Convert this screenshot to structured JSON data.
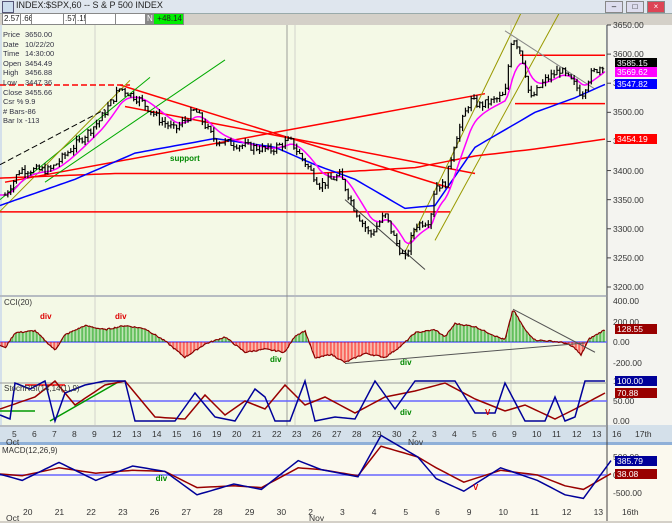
{
  "window": {
    "title": "INDEX:$SPX,60 -- S & P 500 INDEX",
    "buttons": [
      "–",
      "□",
      "×"
    ]
  },
  "toolbar": {
    "fields": [
      "2.57",
      ".66",
      "",
      ".57",
      ".15",
      "",
      ""
    ],
    "flag": "N",
    "change": "+48.14"
  },
  "info": [
    [
      "Price",
      "3650.00"
    ],
    [
      "Date",
      "10/22/20"
    ],
    [
      "Time",
      "14:30:00"
    ],
    [
      "Open",
      "3454.49"
    ],
    [
      "High",
      "3456.88"
    ],
    [
      "Low",
      "3447.36"
    ],
    [
      "Close",
      "3455.66"
    ],
    [
      "Csr %",
      "9.9"
    ],
    [
      "# Bars",
      "-86"
    ],
    [
      "Bar Ix",
      "-113"
    ]
  ],
  "colors": {
    "price": "#000000",
    "ema_fast": "#ff00ff",
    "ema_mid": "#0000ff",
    "ma_slow": "#ff0000",
    "cci_up": "#009900",
    "cci_down": "#ff0000",
    "stoch_k": "#000099",
    "stoch_d": "#990000",
    "macd": "#000099",
    "signal": "#990000",
    "zero": "#6666ff",
    "bg": "#f4f9e6"
  },
  "chart_data": [
    {
      "type": "line",
      "title": "INDEX:$SPX,60 -- S & P 500 INDEX",
      "ylim": [
        3180,
        3680
      ],
      "yticks": [
        "3650.00",
        "3600.00",
        "3550.00",
        "3500.00",
        "3450.00",
        "3400.00",
        "3350.00",
        "3300.00",
        "3250.00",
        "3200.00"
      ],
      "last_values": {
        "price": "3585.15",
        "ema_fast": "3569.62",
        "ema_mid": "3547.82",
        "ma_slow": "3454.19"
      },
      "price_path": [
        [
          -0.5,
          3358
        ],
        [
          0.25,
          3401
        ],
        [
          1.75,
          3401
        ],
        [
          3.25,
          3452
        ],
        [
          4.25,
          3487
        ],
        [
          5.25,
          3542
        ],
        [
          6.25,
          3521
        ],
        [
          7.25,
          3487
        ],
        [
          8,
          3470
        ],
        [
          9,
          3504
        ],
        [
          10,
          3452
        ],
        [
          11.25,
          3444
        ],
        [
          12.75,
          3435
        ],
        [
          13.75,
          3452
        ],
        [
          14.75,
          3401
        ],
        [
          15.25,
          3375
        ],
        [
          16.25,
          3392
        ],
        [
          17,
          3332
        ],
        [
          17.75,
          3289
        ],
        [
          18.5,
          3324
        ],
        [
          19,
          3281
        ],
        [
          19.5,
          3246
        ],
        [
          20,
          3306
        ],
        [
          20.75,
          3315
        ],
        [
          21,
          3375
        ],
        [
          21.5,
          3375
        ],
        [
          22,
          3452
        ],
        [
          22.75,
          3521
        ],
        [
          23.25,
          3512
        ],
        [
          24,
          3521
        ],
        [
          24.5,
          3530
        ],
        [
          24.85,
          3633
        ],
        [
          25.25,
          3607
        ],
        [
          25.5,
          3573
        ],
        [
          25.75,
          3521
        ],
        [
          26.5,
          3555
        ],
        [
          27.25,
          3573
        ],
        [
          28,
          3547
        ],
        [
          28.35,
          3530
        ],
        [
          28.75,
          3564
        ],
        [
          29.5,
          3585
        ]
      ],
      "ema_mid_path": [
        [
          -0.75,
          3340
        ],
        [
          3,
          3385
        ],
        [
          6,
          3430
        ],
        [
          10,
          3455
        ],
        [
          13,
          3440
        ],
        [
          15,
          3410
        ],
        [
          17,
          3385
        ],
        [
          19.5,
          3335
        ],
        [
          21,
          3340
        ],
        [
          23,
          3440
        ],
        [
          26,
          3500
        ],
        [
          28,
          3525
        ],
        [
          29.5,
          3548
        ]
      ],
      "ma_slow_path": [
        [
          -0.75,
          3387
        ],
        [
          5,
          3395
        ],
        [
          10,
          3395
        ],
        [
          15,
          3395
        ],
        [
          20,
          3405
        ],
        [
          23,
          3425
        ],
        [
          26,
          3437
        ],
        [
          29.5,
          3454
        ]
      ],
      "annotations": [
        {
          "text": "support",
          "at": [
            7.75,
            3420
          ]
        }
      ],
      "trendlines": [
        {
          "color": "#ff0000",
          "dash": false,
          "pts": [
            [
              -0.75,
              3329
            ],
            [
              21.75,
              3329
            ]
          ]
        },
        {
          "color": "#ff0000",
          "dash": true,
          "pts": [
            [
              -0.75,
              3547
            ],
            [
              5.75,
              3547
            ]
          ]
        },
        {
          "color": "#ff0000",
          "dash": false,
          "pts": [
            [
              5.25,
              3547
            ],
            [
              21.75,
              3370
            ]
          ]
        },
        {
          "color": "#ff0000",
          "dash": false,
          "pts": [
            [
              5.5,
              3510
            ],
            [
              23,
              3395
            ]
          ]
        },
        {
          "color": "#ff0000",
          "dash": false,
          "pts": [
            [
              -0.5,
              3380
            ],
            [
              23.5,
              3532
            ]
          ]
        },
        {
          "color": "#ff0000",
          "dash": false,
          "pts": [
            [
              25,
              3515
            ],
            [
              29.5,
              3515
            ]
          ]
        },
        {
          "color": "#ff0000",
          "dash": false,
          "pts": [
            [
              25.25,
              3598
            ],
            [
              29.5,
              3598
            ]
          ]
        },
        {
          "color": "#00aa00",
          "dash": false,
          "pts": [
            [
              -0.75,
              3350
            ],
            [
              6.75,
              3560
            ]
          ]
        },
        {
          "color": "#00aa00",
          "dash": false,
          "pts": [
            [
              1.5,
              3380
            ],
            [
              10.5,
              3590
            ]
          ]
        },
        {
          "color": "#999900",
          "dash": false,
          "pts": [
            [
              -0.75,
              3330
            ],
            [
              5.75,
              3555
            ]
          ]
        },
        {
          "color": "#999900",
          "dash": false,
          "pts": [
            [
              19.5,
              3260
            ],
            [
              26,
              3720
            ]
          ]
        },
        {
          "color": "#999900",
          "dash": false,
          "pts": [
            [
              21,
              3280
            ],
            [
              28,
              3720
            ]
          ]
        },
        {
          "color": "#000000",
          "dash": true,
          "pts": [
            [
              -0.75,
              3410
            ],
            [
              4.5,
              3505
            ]
          ]
        },
        {
          "color": "#444444",
          "dash": false,
          "pts": [
            [
              16.5,
              3350
            ],
            [
              20.5,
              3230
            ]
          ]
        },
        {
          "color": "#888888",
          "dash": false,
          "pts": [
            [
              24.5,
              3640
            ],
            [
              29,
              3540
            ]
          ]
        }
      ]
    },
    {
      "type": "bar",
      "title": "CCI(20)",
      "ylim": [
        -300,
        400
      ],
      "yticks": [
        "400.00",
        "200.00",
        "0.00",
        "-200.00"
      ],
      "last": "128.55",
      "values": [
        [
          -0.75,
          -30
        ],
        [
          -0.5,
          -60
        ],
        [
          0,
          90
        ],
        [
          1,
          110
        ],
        [
          2,
          -80
        ],
        [
          2.5,
          70
        ],
        [
          3.5,
          160
        ],
        [
          4.5,
          120
        ],
        [
          5.5,
          160
        ],
        [
          6.5,
          130
        ],
        [
          7.5,
          10
        ],
        [
          8.5,
          -150
        ],
        [
          9.5,
          -20
        ],
        [
          10.5,
          50
        ],
        [
          11.5,
          -100
        ],
        [
          12.5,
          -70
        ],
        [
          13.5,
          -100
        ],
        [
          14,
          60
        ],
        [
          14.5,
          110
        ],
        [
          15,
          -160
        ],
        [
          15.8,
          -120
        ],
        [
          16.5,
          -200
        ],
        [
          17.5,
          -110
        ],
        [
          18.5,
          -150
        ],
        [
          19.3,
          -40
        ],
        [
          20,
          90
        ],
        [
          21,
          120
        ],
        [
          21.5,
          50
        ],
        [
          22,
          180
        ],
        [
          23,
          150
        ],
        [
          24,
          60
        ],
        [
          24.5,
          20
        ],
        [
          24.9,
          320
        ],
        [
          25.5,
          120
        ],
        [
          26,
          20
        ],
        [
          27,
          5
        ],
        [
          27.5,
          -10
        ],
        [
          28,
          -60
        ],
        [
          28.3,
          -130
        ],
        [
          28.7,
          30
        ],
        [
          29.5,
          120
        ]
      ],
      "labels": [
        {
          "text": "div",
          "color": "#dd0000",
          "at": [
            1.25,
            240
          ]
        },
        {
          "text": "div",
          "color": "#dd0000",
          "at": [
            5,
            240
          ]
        },
        {
          "text": "div",
          "color": "#008800",
          "at": [
            12.75,
            -180
          ]
        },
        {
          "text": "div",
          "color": "#008800",
          "at": [
            19.25,
            -200
          ]
        }
      ]
    },
    {
      "type": "line",
      "title": "StochRSI(14,14(1),9)",
      "ylim": [
        0,
        100
      ],
      "yticks": [
        "100.00",
        "50.00",
        "0.00"
      ],
      "last_k": "100.00",
      "last_d": "70.88",
      "k": [
        [
          -0.75,
          15
        ],
        [
          -0.25,
          5
        ],
        [
          0,
          95
        ],
        [
          0.75,
          80
        ],
        [
          1.5,
          100
        ],
        [
          2,
          0
        ],
        [
          2.5,
          70
        ],
        [
          3.5,
          90
        ],
        [
          4.5,
          100
        ],
        [
          5.5,
          100
        ],
        [
          6,
          0
        ],
        [
          7,
          0
        ],
        [
          8,
          0
        ],
        [
          9,
          70
        ],
        [
          10,
          10
        ],
        [
          11,
          0
        ],
        [
          12,
          80
        ],
        [
          12.5,
          60
        ],
        [
          13,
          0
        ],
        [
          13.75,
          0
        ],
        [
          14.5,
          100
        ],
        [
          15,
          0
        ],
        [
          16,
          10
        ],
        [
          17,
          5
        ],
        [
          18,
          100
        ],
        [
          19,
          30
        ],
        [
          20,
          100
        ],
        [
          21,
          100
        ],
        [
          22,
          100
        ],
        [
          23,
          20
        ],
        [
          24,
          20
        ],
        [
          24.5,
          95
        ],
        [
          25.5,
          0
        ],
        [
          26.5,
          0
        ],
        [
          27,
          60
        ],
        [
          27.5,
          0
        ],
        [
          28,
          10
        ],
        [
          28.5,
          100
        ],
        [
          29.5,
          100
        ]
      ],
      "d": [
        [
          -0.75,
          30
        ],
        [
          1,
          60
        ],
        [
          2,
          100
        ],
        [
          3,
          40
        ],
        [
          4.5,
          90
        ],
        [
          5.5,
          100
        ],
        [
          7,
          10
        ],
        [
          8.5,
          5
        ],
        [
          9.5,
          65
        ],
        [
          10.5,
          15
        ],
        [
          11.5,
          50
        ],
        [
          12.5,
          30
        ],
        [
          13.5,
          90
        ],
        [
          14.5,
          40
        ],
        [
          15.5,
          60
        ],
        [
          17,
          20
        ],
        [
          18.5,
          60
        ],
        [
          20,
          75
        ],
        [
          21.5,
          95
        ],
        [
          23,
          55
        ],
        [
          24.5,
          25
        ],
        [
          25.5,
          40
        ],
        [
          27,
          5
        ],
        [
          28,
          30
        ],
        [
          29.5,
          70
        ]
      ],
      "lines": [
        {
          "color": "#ff0000",
          "pts": [
            [
              0.5,
              90
            ],
            [
              2.5,
              90
            ]
          ]
        },
        {
          "color": "#009900",
          "pts": [
            [
              -0.75,
              25
            ],
            [
              1,
              25
            ]
          ]
        },
        {
          "color": "#009900",
          "pts": [
            [
              1.75,
              0
            ],
            [
              5.25,
              100
            ]
          ]
        }
      ],
      "labels": [
        {
          "text": "div",
          "color": "#008800",
          "at": [
            19.25,
            20
          ]
        },
        {
          "text": "V",
          "color": "#dd0000",
          "at": [
            23.5,
            20
          ]
        }
      ],
      "xticks": [
        "5",
        "6",
        "7",
        "8",
        "9",
        "12",
        "13",
        "14",
        "15",
        "16",
        "19",
        "20",
        "21",
        "22",
        "23",
        "26",
        "27",
        "28",
        "29",
        "30",
        "2",
        "3",
        "4",
        "5",
        "6",
        "9",
        "10",
        "11",
        "12",
        "13",
        "16",
        "17th"
      ],
      "xgroups": [
        "Oct",
        "Nov"
      ]
    },
    {
      "type": "line",
      "title": "MACD(12,26,9)",
      "ylim": [
        -700,
        700
      ],
      "yticks": [
        "500.00",
        "0.00",
        "-500.00"
      ],
      "last_macd": "385.79",
      "last_signal": "38.08",
      "macd": [
        [
          -0.75,
          100
        ],
        [
          1,
          -150
        ],
        [
          3,
          350
        ],
        [
          5,
          -150
        ],
        [
          7,
          250
        ],
        [
          8.75,
          100
        ],
        [
          10.5,
          -550
        ],
        [
          12.5,
          -250
        ],
        [
          14,
          -400
        ],
        [
          16,
          400
        ],
        [
          17.25,
          150
        ],
        [
          19.25,
          -50
        ],
        [
          20.5,
          1100
        ],
        [
          22.5,
          500
        ],
        [
          23.5,
          -100
        ],
        [
          25,
          -450
        ],
        [
          27,
          200
        ],
        [
          29,
          -150
        ],
        [
          30.5,
          -550
        ],
        [
          31.5,
          -650
        ],
        [
          33,
          400
        ]
      ],
      "signal": [
        [
          -0.75,
          50
        ],
        [
          1,
          -20
        ],
        [
          3,
          200
        ],
        [
          5,
          50
        ],
        [
          7,
          130
        ],
        [
          8.75,
          100
        ],
        [
          10.5,
          -350
        ],
        [
          12.5,
          -300
        ],
        [
          14,
          -350
        ],
        [
          16,
          200
        ],
        [
          17.25,
          150
        ],
        [
          19.25,
          -20
        ],
        [
          20.5,
          800
        ],
        [
          22.5,
          500
        ],
        [
          23.5,
          200
        ],
        [
          25,
          -200
        ],
        [
          27,
          130
        ],
        [
          29,
          0
        ],
        [
          30.5,
          -300
        ],
        [
          31.5,
          -400
        ],
        [
          33,
          40
        ]
      ],
      "labels": [
        {
          "text": "div",
          "color": "#008800",
          "at": [
            8.25,
            -100
          ]
        },
        {
          "text": "V",
          "color": "#dd0000",
          "at": [
            25.5,
            -350
          ]
        }
      ],
      "xticks": [
        "20",
        "21",
        "22",
        "23",
        "26",
        "27",
        "28",
        "29",
        "30",
        "2",
        "3",
        "4",
        "5",
        "6",
        "9",
        "10",
        "11",
        "12",
        "13",
        "16th"
      ],
      "xgroups": [
        "Oct",
        "Nov"
      ]
    }
  ]
}
